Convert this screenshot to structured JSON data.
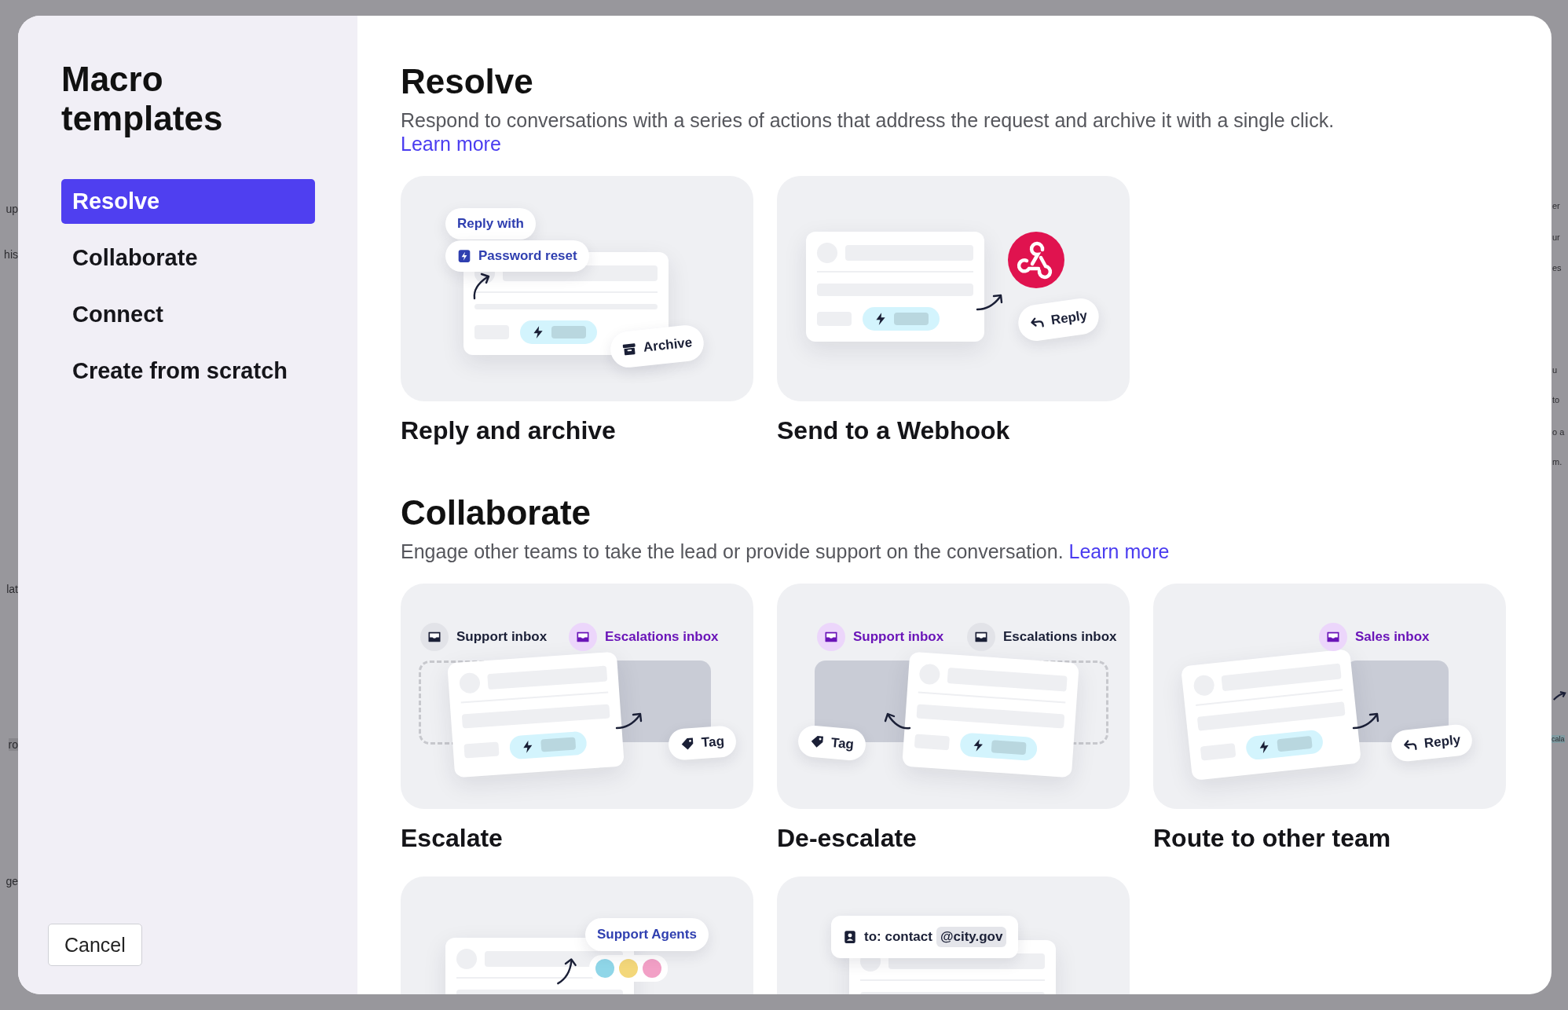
{
  "backdrop": {
    "left_fragments": [
      "up",
      "his",
      "lat",
      "ro",
      "ge"
    ],
    "right_fragments": [
      "er",
      "ur",
      "es",
      "u",
      "to",
      "o a",
      "m.",
      "cala"
    ]
  },
  "sidebar": {
    "title": "Macro templates",
    "items": [
      {
        "label": "Resolve",
        "selected": true
      },
      {
        "label": "Collaborate",
        "selected": false
      },
      {
        "label": "Connect",
        "selected": false
      },
      {
        "label": "Create from scratch",
        "selected": false
      }
    ],
    "cancel_button": "Cancel"
  },
  "sections": [
    {
      "title": "Resolve",
      "description": "Respond to conversations with a series of actions that address the request and archive it with a single click.",
      "link": "Learn more",
      "templates": [
        {
          "kind": "reply-archive",
          "name": "Reply and archive",
          "labels": [
            {
              "kind": "text",
              "text": "Reply with"
            },
            {
              "kind": "macro",
              "text": "Password reset"
            },
            {
              "kind": "archive",
              "text": "Archive"
            }
          ]
        },
        {
          "kind": "webhook",
          "name": "Send to a Webhook",
          "labels": [
            {
              "kind": "reply",
              "text": "Reply"
            }
          ]
        }
      ]
    },
    {
      "title": "Collaborate",
      "description": "Engage other teams to take the lead or provide support on the conversation.",
      "link": "Learn more",
      "templates": [
        {
          "kind": "escalate",
          "name": "Escalate",
          "labels": [
            {
              "kind": "inbox",
              "text": "Support inbox",
              "active": false
            },
            {
              "kind": "inbox",
              "text": "Escalations inbox",
              "active": true
            },
            {
              "kind": "tag",
              "text": "Tag"
            }
          ]
        },
        {
          "kind": "de-escalate",
          "name": "De-escalate",
          "labels": [
            {
              "kind": "inbox",
              "text": "Support inbox",
              "active": true
            },
            {
              "kind": "inbox",
              "text": "Escalations inbox",
              "active": false
            },
            {
              "kind": "tag",
              "text": "Tag"
            }
          ]
        },
        {
          "kind": "route",
          "name": "Route to other team",
          "labels": [
            {
              "kind": "inbox",
              "text": "Sales inbox",
              "active": true
            },
            {
              "kind": "reply",
              "text": "Reply"
            }
          ]
        },
        {
          "kind": "agents",
          "labels": [
            {
              "kind": "text",
              "text": "Support Agents"
            }
          ]
        },
        {
          "kind": "contact",
          "labels": [
            {
              "kind": "contact",
              "text": "to: contact",
              "address": "@city.gov"
            }
          ]
        }
      ]
    }
  ]
}
